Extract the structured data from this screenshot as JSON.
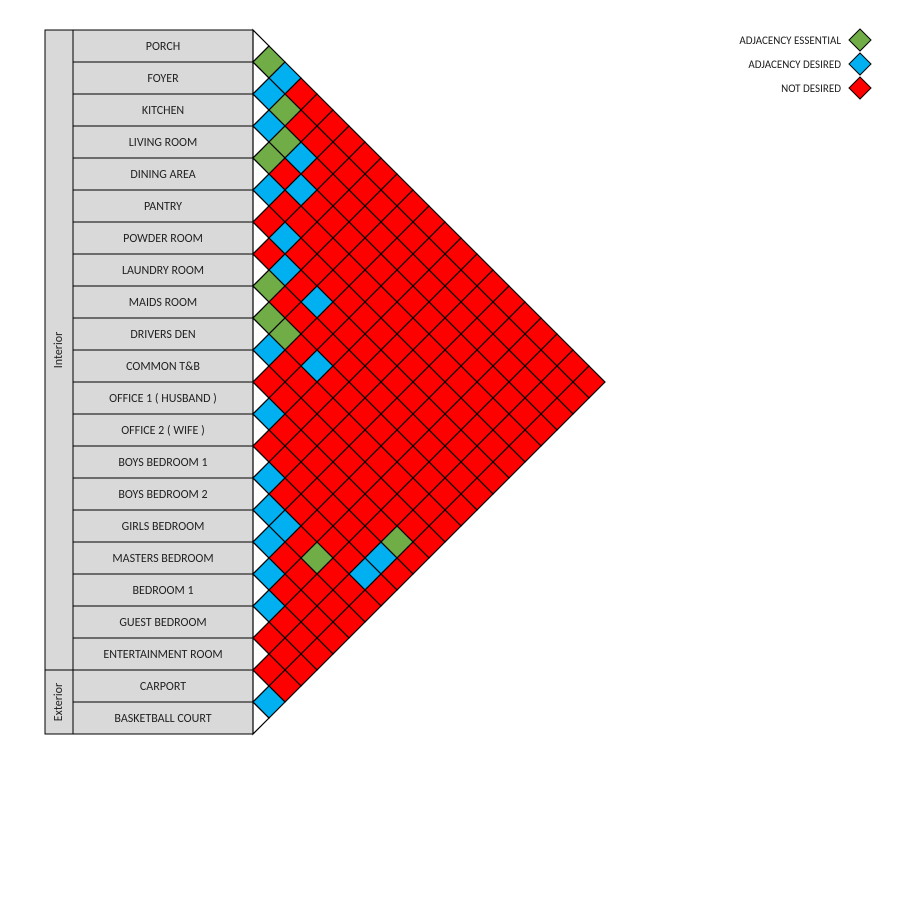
{
  "legend": {
    "essential": "ADJACENCY ESSENTIAL",
    "desired": "ADJACENCY DESIRED",
    "not": "NOT DESIRED"
  },
  "colors": {
    "essential": "#70AD47",
    "desired": "#00B0F0",
    "not": "#FF0000",
    "border": "#000000",
    "roomFill": "#D9D9D9"
  },
  "categories": [
    {
      "name": "Interior",
      "from": 0,
      "to": 19
    },
    {
      "name": "Exterior",
      "from": 20,
      "to": 21
    }
  ],
  "rooms": [
    "PORCH",
    "FOYER",
    "KITCHEN",
    "LIVING ROOM",
    "DINING AREA",
    "PANTRY",
    "POWDER ROOM",
    "LAUNDRY ROOM",
    "MAIDS ROOM",
    "DRIVERS DEN",
    "COMMON T&B",
    "OFFICE 1 ( HUSBAND )",
    "OFFICE 2 ( WIFE )",
    "BOYS BEDROOM 1",
    "BOYS BEDROOM 2",
    "GIRLS BEDROOM",
    "MASTERS BEDROOM",
    "BEDROOM 1",
    "GUEST BEDROOM",
    "ENTERTAINMENT ROOM",
    "CARPORT",
    "BASKETBALL COURT"
  ],
  "chart_data": {
    "type": "adjacency-matrix",
    "levels": {
      "E": "essential",
      "D": "desired",
      "N": "not"
    },
    "pairs": [
      [
        "PORCH",
        "FOYER",
        "E"
      ],
      [
        "PORCH",
        "KITCHEN",
        "D"
      ],
      [
        "PORCH",
        "LIVING ROOM",
        "N"
      ],
      [
        "PORCH",
        "DINING AREA",
        "N"
      ],
      [
        "PORCH",
        "PANTRY",
        "N"
      ],
      [
        "PORCH",
        "POWDER ROOM",
        "N"
      ],
      [
        "PORCH",
        "LAUNDRY ROOM",
        "N"
      ],
      [
        "PORCH",
        "MAIDS ROOM",
        "N"
      ],
      [
        "PORCH",
        "DRIVERS DEN",
        "N"
      ],
      [
        "PORCH",
        "COMMON T&B",
        "N"
      ],
      [
        "PORCH",
        "OFFICE 1 ( HUSBAND )",
        "N"
      ],
      [
        "PORCH",
        "OFFICE 2 ( WIFE )",
        "N"
      ],
      [
        "PORCH",
        "BOYS BEDROOM 1",
        "N"
      ],
      [
        "PORCH",
        "BOYS BEDROOM 2",
        "N"
      ],
      [
        "PORCH",
        "GIRLS BEDROOM",
        "N"
      ],
      [
        "PORCH",
        "MASTERS BEDROOM",
        "N"
      ],
      [
        "PORCH",
        "BEDROOM 1",
        "N"
      ],
      [
        "PORCH",
        "GUEST BEDROOM",
        "N"
      ],
      [
        "PORCH",
        "ENTERTAINMENT ROOM",
        "N"
      ],
      [
        "PORCH",
        "CARPORT",
        "N"
      ],
      [
        "PORCH",
        "BASKETBALL COURT",
        "N"
      ],
      [
        "FOYER",
        "KITCHEN",
        "D"
      ],
      [
        "FOYER",
        "LIVING ROOM",
        "E"
      ],
      [
        "FOYER",
        "DINING AREA",
        "N"
      ],
      [
        "FOYER",
        "PANTRY",
        "N"
      ],
      [
        "FOYER",
        "POWDER ROOM",
        "N"
      ],
      [
        "FOYER",
        "LAUNDRY ROOM",
        "N"
      ],
      [
        "FOYER",
        "MAIDS ROOM",
        "N"
      ],
      [
        "FOYER",
        "DRIVERS DEN",
        "N"
      ],
      [
        "FOYER",
        "COMMON T&B",
        "N"
      ],
      [
        "FOYER",
        "OFFICE 1 ( HUSBAND )",
        "N"
      ],
      [
        "FOYER",
        "OFFICE 2 ( WIFE )",
        "N"
      ],
      [
        "FOYER",
        "BOYS BEDROOM 1",
        "N"
      ],
      [
        "FOYER",
        "BOYS BEDROOM 2",
        "N"
      ],
      [
        "FOYER",
        "GIRLS BEDROOM",
        "N"
      ],
      [
        "FOYER",
        "MASTERS BEDROOM",
        "N"
      ],
      [
        "FOYER",
        "BEDROOM 1",
        "N"
      ],
      [
        "FOYER",
        "GUEST BEDROOM",
        "N"
      ],
      [
        "FOYER",
        "ENTERTAINMENT ROOM",
        "N"
      ],
      [
        "FOYER",
        "CARPORT",
        "N"
      ],
      [
        "FOYER",
        "BASKETBALL COURT",
        "N"
      ],
      [
        "KITCHEN",
        "LIVING ROOM",
        "D"
      ],
      [
        "KITCHEN",
        "DINING AREA",
        "E"
      ],
      [
        "KITCHEN",
        "PANTRY",
        "D"
      ],
      [
        "KITCHEN",
        "POWDER ROOM",
        "N"
      ],
      [
        "KITCHEN",
        "LAUNDRY ROOM",
        "N"
      ],
      [
        "KITCHEN",
        "MAIDS ROOM",
        "N"
      ],
      [
        "KITCHEN",
        "DRIVERS DEN",
        "N"
      ],
      [
        "KITCHEN",
        "COMMON T&B",
        "N"
      ],
      [
        "KITCHEN",
        "OFFICE 1 ( HUSBAND )",
        "N"
      ],
      [
        "KITCHEN",
        "OFFICE 2 ( WIFE )",
        "N"
      ],
      [
        "KITCHEN",
        "BOYS BEDROOM 1",
        "N"
      ],
      [
        "KITCHEN",
        "BOYS BEDROOM 2",
        "N"
      ],
      [
        "KITCHEN",
        "GIRLS BEDROOM",
        "N"
      ],
      [
        "KITCHEN",
        "MASTERS BEDROOM",
        "N"
      ],
      [
        "KITCHEN",
        "BEDROOM 1",
        "N"
      ],
      [
        "KITCHEN",
        "GUEST BEDROOM",
        "N"
      ],
      [
        "KITCHEN",
        "ENTERTAINMENT ROOM",
        "N"
      ],
      [
        "KITCHEN",
        "CARPORT",
        "N"
      ],
      [
        "KITCHEN",
        "BASKETBALL COURT",
        "N"
      ],
      [
        "LIVING ROOM",
        "DINING AREA",
        "E"
      ],
      [
        "LIVING ROOM",
        "PANTRY",
        "N"
      ],
      [
        "LIVING ROOM",
        "POWDER ROOM",
        "D"
      ],
      [
        "LIVING ROOM",
        "LAUNDRY ROOM",
        "N"
      ],
      [
        "LIVING ROOM",
        "MAIDS ROOM",
        "N"
      ],
      [
        "LIVING ROOM",
        "DRIVERS DEN",
        "N"
      ],
      [
        "LIVING ROOM",
        "COMMON T&B",
        "N"
      ],
      [
        "LIVING ROOM",
        "OFFICE 1 ( HUSBAND )",
        "N"
      ],
      [
        "LIVING ROOM",
        "OFFICE 2 ( WIFE )",
        "N"
      ],
      [
        "LIVING ROOM",
        "BOYS BEDROOM 1",
        "N"
      ],
      [
        "LIVING ROOM",
        "BOYS BEDROOM 2",
        "N"
      ],
      [
        "LIVING ROOM",
        "GIRLS BEDROOM",
        "N"
      ],
      [
        "LIVING ROOM",
        "MASTERS BEDROOM",
        "N"
      ],
      [
        "LIVING ROOM",
        "BEDROOM 1",
        "N"
      ],
      [
        "LIVING ROOM",
        "GUEST BEDROOM",
        "N"
      ],
      [
        "LIVING ROOM",
        "ENTERTAINMENT ROOM",
        "N"
      ],
      [
        "LIVING ROOM",
        "CARPORT",
        "N"
      ],
      [
        "LIVING ROOM",
        "BASKETBALL COURT",
        "N"
      ],
      [
        "DINING AREA",
        "PANTRY",
        "D"
      ],
      [
        "DINING AREA",
        "POWDER ROOM",
        "N"
      ],
      [
        "DINING AREA",
        "LAUNDRY ROOM",
        "N"
      ],
      [
        "DINING AREA",
        "MAIDS ROOM",
        "N"
      ],
      [
        "DINING AREA",
        "DRIVERS DEN",
        "N"
      ],
      [
        "DINING AREA",
        "COMMON T&B",
        "N"
      ],
      [
        "DINING AREA",
        "OFFICE 1 ( HUSBAND )",
        "N"
      ],
      [
        "DINING AREA",
        "OFFICE 2 ( WIFE )",
        "N"
      ],
      [
        "DINING AREA",
        "BOYS BEDROOM 1",
        "N"
      ],
      [
        "DINING AREA",
        "BOYS BEDROOM 2",
        "N"
      ],
      [
        "DINING AREA",
        "GIRLS BEDROOM",
        "N"
      ],
      [
        "DINING AREA",
        "MASTERS BEDROOM",
        "N"
      ],
      [
        "DINING AREA",
        "BEDROOM 1",
        "N"
      ],
      [
        "DINING AREA",
        "GUEST BEDROOM",
        "N"
      ],
      [
        "DINING AREA",
        "ENTERTAINMENT ROOM",
        "N"
      ],
      [
        "DINING AREA",
        "CARPORT",
        "N"
      ],
      [
        "DINING AREA",
        "BASKETBALL COURT",
        "N"
      ],
      [
        "PANTRY",
        "POWDER ROOM",
        "N"
      ],
      [
        "PANTRY",
        "LAUNDRY ROOM",
        "D"
      ],
      [
        "PANTRY",
        "MAIDS ROOM",
        "N"
      ],
      [
        "PANTRY",
        "DRIVERS DEN",
        "N"
      ],
      [
        "PANTRY",
        "COMMON T&B",
        "N"
      ],
      [
        "PANTRY",
        "OFFICE 1 ( HUSBAND )",
        "N"
      ],
      [
        "PANTRY",
        "OFFICE 2 ( WIFE )",
        "N"
      ],
      [
        "PANTRY",
        "BOYS BEDROOM 1",
        "N"
      ],
      [
        "PANTRY",
        "BOYS BEDROOM 2",
        "N"
      ],
      [
        "PANTRY",
        "GIRLS BEDROOM",
        "N"
      ],
      [
        "PANTRY",
        "MASTERS BEDROOM",
        "N"
      ],
      [
        "PANTRY",
        "BEDROOM 1",
        "N"
      ],
      [
        "PANTRY",
        "GUEST BEDROOM",
        "N"
      ],
      [
        "PANTRY",
        "ENTERTAINMENT ROOM",
        "N"
      ],
      [
        "PANTRY",
        "CARPORT",
        "N"
      ],
      [
        "PANTRY",
        "BASKETBALL COURT",
        "N"
      ],
      [
        "POWDER ROOM",
        "LAUNDRY ROOM",
        "N"
      ],
      [
        "POWDER ROOM",
        "MAIDS ROOM",
        "D"
      ],
      [
        "POWDER ROOM",
        "DRIVERS DEN",
        "N"
      ],
      [
        "POWDER ROOM",
        "COMMON T&B",
        "D"
      ],
      [
        "POWDER ROOM",
        "OFFICE 1 ( HUSBAND )",
        "N"
      ],
      [
        "POWDER ROOM",
        "OFFICE 2 ( WIFE )",
        "N"
      ],
      [
        "POWDER ROOM",
        "BOYS BEDROOM 1",
        "N"
      ],
      [
        "POWDER ROOM",
        "BOYS BEDROOM 2",
        "N"
      ],
      [
        "POWDER ROOM",
        "GIRLS BEDROOM",
        "N"
      ],
      [
        "POWDER ROOM",
        "MASTERS BEDROOM",
        "N"
      ],
      [
        "POWDER ROOM",
        "BEDROOM 1",
        "N"
      ],
      [
        "POWDER ROOM",
        "GUEST BEDROOM",
        "N"
      ],
      [
        "POWDER ROOM",
        "ENTERTAINMENT ROOM",
        "N"
      ],
      [
        "POWDER ROOM",
        "CARPORT",
        "N"
      ],
      [
        "POWDER ROOM",
        "BASKETBALL COURT",
        "N"
      ],
      [
        "LAUNDRY ROOM",
        "MAIDS ROOM",
        "E"
      ],
      [
        "LAUNDRY ROOM",
        "DRIVERS DEN",
        "N"
      ],
      [
        "LAUNDRY ROOM",
        "COMMON T&B",
        "N"
      ],
      [
        "LAUNDRY ROOM",
        "OFFICE 1 ( HUSBAND )",
        "N"
      ],
      [
        "LAUNDRY ROOM",
        "OFFICE 2 ( WIFE )",
        "N"
      ],
      [
        "LAUNDRY ROOM",
        "BOYS BEDROOM 1",
        "N"
      ],
      [
        "LAUNDRY ROOM",
        "BOYS BEDROOM 2",
        "N"
      ],
      [
        "LAUNDRY ROOM",
        "GIRLS BEDROOM",
        "N"
      ],
      [
        "LAUNDRY ROOM",
        "MASTERS BEDROOM",
        "N"
      ],
      [
        "LAUNDRY ROOM",
        "BEDROOM 1",
        "N"
      ],
      [
        "LAUNDRY ROOM",
        "GUEST BEDROOM",
        "N"
      ],
      [
        "LAUNDRY ROOM",
        "ENTERTAINMENT ROOM",
        "N"
      ],
      [
        "LAUNDRY ROOM",
        "CARPORT",
        "N"
      ],
      [
        "LAUNDRY ROOM",
        "BASKETBALL COURT",
        "N"
      ],
      [
        "MAIDS ROOM",
        "DRIVERS DEN",
        "E"
      ],
      [
        "MAIDS ROOM",
        "COMMON T&B",
        "E"
      ],
      [
        "MAIDS ROOM",
        "OFFICE 1 ( HUSBAND )",
        "N"
      ],
      [
        "MAIDS ROOM",
        "OFFICE 2 ( WIFE )",
        "D"
      ],
      [
        "MAIDS ROOM",
        "BOYS BEDROOM 1",
        "N"
      ],
      [
        "MAIDS ROOM",
        "BOYS BEDROOM 2",
        "N"
      ],
      [
        "MAIDS ROOM",
        "GIRLS BEDROOM",
        "N"
      ],
      [
        "MAIDS ROOM",
        "MASTERS BEDROOM",
        "N"
      ],
      [
        "MAIDS ROOM",
        "BEDROOM 1",
        "N"
      ],
      [
        "MAIDS ROOM",
        "GUEST BEDROOM",
        "N"
      ],
      [
        "MAIDS ROOM",
        "ENTERTAINMENT ROOM",
        "N"
      ],
      [
        "MAIDS ROOM",
        "CARPORT",
        "N"
      ],
      [
        "MAIDS ROOM",
        "BASKETBALL COURT",
        "N"
      ],
      [
        "DRIVERS DEN",
        "COMMON T&B",
        "D"
      ],
      [
        "DRIVERS DEN",
        "OFFICE 1 ( HUSBAND )",
        "N"
      ],
      [
        "DRIVERS DEN",
        "OFFICE 2 ( WIFE )",
        "N"
      ],
      [
        "DRIVERS DEN",
        "BOYS BEDROOM 1",
        "N"
      ],
      [
        "DRIVERS DEN",
        "BOYS BEDROOM 2",
        "N"
      ],
      [
        "DRIVERS DEN",
        "GIRLS BEDROOM",
        "N"
      ],
      [
        "DRIVERS DEN",
        "MASTERS BEDROOM",
        "N"
      ],
      [
        "DRIVERS DEN",
        "BEDROOM 1",
        "N"
      ],
      [
        "DRIVERS DEN",
        "GUEST BEDROOM",
        "N"
      ],
      [
        "DRIVERS DEN",
        "ENTERTAINMENT ROOM",
        "N"
      ],
      [
        "DRIVERS DEN",
        "CARPORT",
        "N"
      ],
      [
        "DRIVERS DEN",
        "BASKETBALL COURT",
        "N"
      ],
      [
        "COMMON T&B",
        "OFFICE 1 ( HUSBAND )",
        "N"
      ],
      [
        "COMMON T&B",
        "OFFICE 2 ( WIFE )",
        "N"
      ],
      [
        "COMMON T&B",
        "BOYS BEDROOM 1",
        "N"
      ],
      [
        "COMMON T&B",
        "BOYS BEDROOM 2",
        "N"
      ],
      [
        "COMMON T&B",
        "GIRLS BEDROOM",
        "N"
      ],
      [
        "COMMON T&B",
        "MASTERS BEDROOM",
        "N"
      ],
      [
        "COMMON T&B",
        "BEDROOM 1",
        "N"
      ],
      [
        "COMMON T&B",
        "GUEST BEDROOM",
        "N"
      ],
      [
        "COMMON T&B",
        "ENTERTAINMENT ROOM",
        "N"
      ],
      [
        "COMMON T&B",
        "CARPORT",
        "N"
      ],
      [
        "COMMON T&B",
        "BASKETBALL COURT",
        "N"
      ],
      [
        "OFFICE 1 ( HUSBAND )",
        "OFFICE 2 ( WIFE )",
        "D"
      ],
      [
        "OFFICE 1 ( HUSBAND )",
        "BOYS BEDROOM 1",
        "N"
      ],
      [
        "OFFICE 1 ( HUSBAND )",
        "BOYS BEDROOM 2",
        "N"
      ],
      [
        "OFFICE 1 ( HUSBAND )",
        "GIRLS BEDROOM",
        "N"
      ],
      [
        "OFFICE 1 ( HUSBAND )",
        "MASTERS BEDROOM",
        "N"
      ],
      [
        "OFFICE 1 ( HUSBAND )",
        "BEDROOM 1",
        "N"
      ],
      [
        "OFFICE 1 ( HUSBAND )",
        "GUEST BEDROOM",
        "N"
      ],
      [
        "OFFICE 1 ( HUSBAND )",
        "ENTERTAINMENT ROOM",
        "N"
      ],
      [
        "OFFICE 1 ( HUSBAND )",
        "CARPORT",
        "E"
      ],
      [
        "OFFICE 1 ( HUSBAND )",
        "BASKETBALL COURT",
        "N"
      ],
      [
        "OFFICE 2 ( WIFE )",
        "BOYS BEDROOM 1",
        "N"
      ],
      [
        "OFFICE 2 ( WIFE )",
        "BOYS BEDROOM 2",
        "N"
      ],
      [
        "OFFICE 2 ( WIFE )",
        "GIRLS BEDROOM",
        "N"
      ],
      [
        "OFFICE 2 ( WIFE )",
        "MASTERS BEDROOM",
        "N"
      ],
      [
        "OFFICE 2 ( WIFE )",
        "BEDROOM 1",
        "N"
      ],
      [
        "OFFICE 2 ( WIFE )",
        "GUEST BEDROOM",
        "N"
      ],
      [
        "OFFICE 2 ( WIFE )",
        "ENTERTAINMENT ROOM",
        "N"
      ],
      [
        "OFFICE 2 ( WIFE )",
        "CARPORT",
        "D"
      ],
      [
        "OFFICE 2 ( WIFE )",
        "BASKETBALL COURT",
        "N"
      ],
      [
        "BOYS BEDROOM 1",
        "BOYS BEDROOM 2",
        "D"
      ],
      [
        "BOYS BEDROOM 1",
        "GIRLS BEDROOM",
        "N"
      ],
      [
        "BOYS BEDROOM 1",
        "MASTERS BEDROOM",
        "N"
      ],
      [
        "BOYS BEDROOM 1",
        "BEDROOM 1",
        "N"
      ],
      [
        "BOYS BEDROOM 1",
        "GUEST BEDROOM",
        "N"
      ],
      [
        "BOYS BEDROOM 1",
        "ENTERTAINMENT ROOM",
        "N"
      ],
      [
        "BOYS BEDROOM 1",
        "CARPORT",
        "D"
      ],
      [
        "BOYS BEDROOM 1",
        "BASKETBALL COURT",
        "N"
      ],
      [
        "BOYS BEDROOM 2",
        "GIRLS BEDROOM",
        "D"
      ],
      [
        "BOYS BEDROOM 2",
        "MASTERS BEDROOM",
        "D"
      ],
      [
        "BOYS BEDROOM 2",
        "BEDROOM 1",
        "N"
      ],
      [
        "BOYS BEDROOM 2",
        "GUEST BEDROOM",
        "E"
      ],
      [
        "BOYS BEDROOM 2",
        "ENTERTAINMENT ROOM",
        "N"
      ],
      [
        "BOYS BEDROOM 2",
        "CARPORT",
        "N"
      ],
      [
        "BOYS BEDROOM 2",
        "BASKETBALL COURT",
        "N"
      ],
      [
        "GIRLS BEDROOM",
        "MASTERS BEDROOM",
        "D"
      ],
      [
        "GIRLS BEDROOM",
        "BEDROOM 1",
        "N"
      ],
      [
        "GIRLS BEDROOM",
        "GUEST BEDROOM",
        "N"
      ],
      [
        "GIRLS BEDROOM",
        "ENTERTAINMENT ROOM",
        "N"
      ],
      [
        "GIRLS BEDROOM",
        "CARPORT",
        "N"
      ],
      [
        "GIRLS BEDROOM",
        "BASKETBALL COURT",
        "N"
      ],
      [
        "MASTERS BEDROOM",
        "BEDROOM 1",
        "D"
      ],
      [
        "MASTERS BEDROOM",
        "GUEST BEDROOM",
        "N"
      ],
      [
        "MASTERS BEDROOM",
        "ENTERTAINMENT ROOM",
        "N"
      ],
      [
        "MASTERS BEDROOM",
        "CARPORT",
        "N"
      ],
      [
        "MASTERS BEDROOM",
        "BASKETBALL COURT",
        "N"
      ],
      [
        "BEDROOM 1",
        "GUEST BEDROOM",
        "D"
      ],
      [
        "BEDROOM 1",
        "ENTERTAINMENT ROOM",
        "N"
      ],
      [
        "BEDROOM 1",
        "CARPORT",
        "N"
      ],
      [
        "BEDROOM 1",
        "BASKETBALL COURT",
        "N"
      ],
      [
        "GUEST BEDROOM",
        "ENTERTAINMENT ROOM",
        "N"
      ],
      [
        "GUEST BEDROOM",
        "CARPORT",
        "N"
      ],
      [
        "GUEST BEDROOM",
        "BASKETBALL COURT",
        "N"
      ],
      [
        "ENTERTAINMENT ROOM",
        "CARPORT",
        "N"
      ],
      [
        "ENTERTAINMENT ROOM",
        "BASKETBALL COURT",
        "N"
      ],
      [
        "CARPORT",
        "BASKETBALL COURT",
        "D"
      ]
    ]
  }
}
